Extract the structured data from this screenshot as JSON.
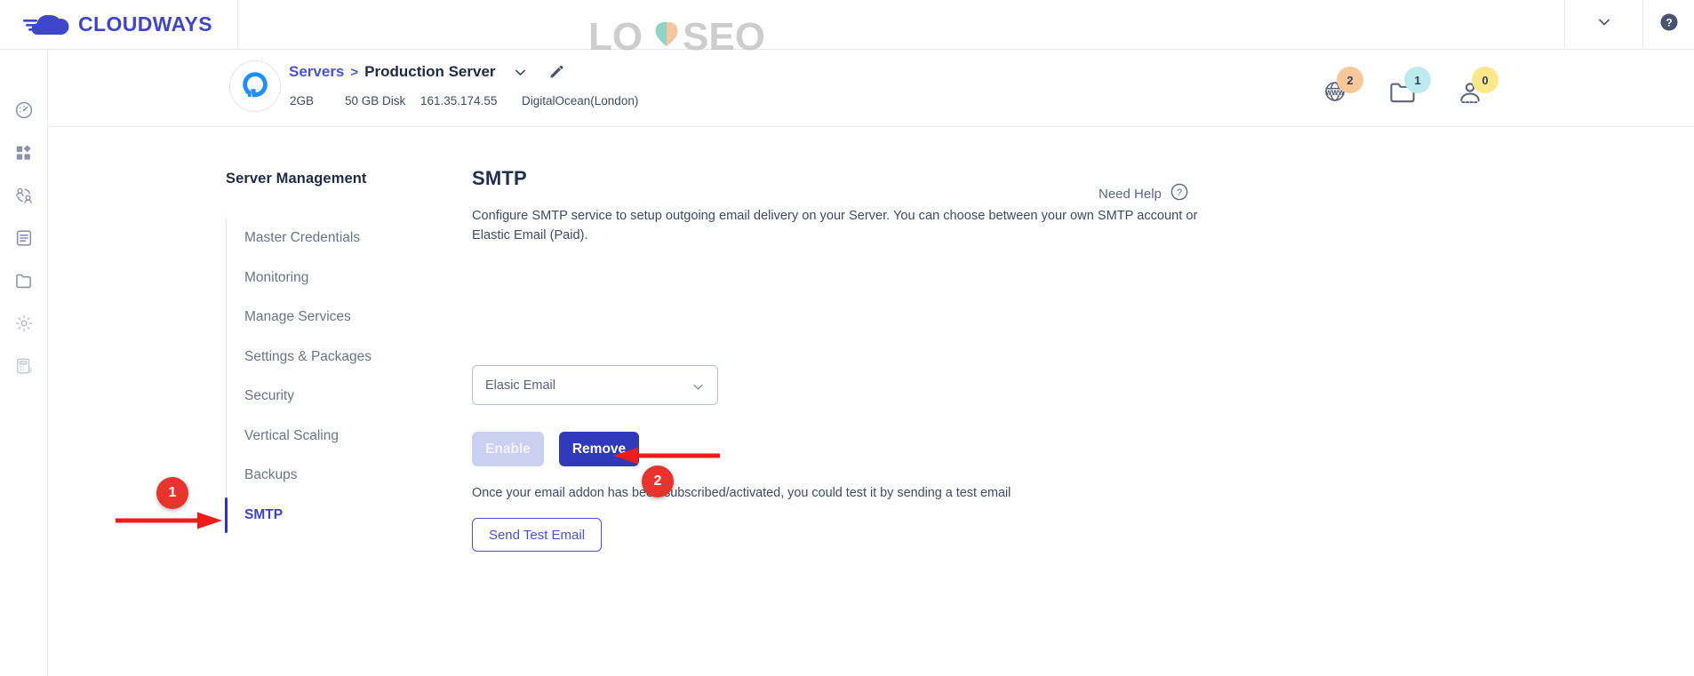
{
  "topbar": {
    "brand_name": "CLOUDWAYS",
    "brand_logo_icon": "cloudways-cloud-logo",
    "caret_icon": "chevron-down-icon",
    "help_icon": "question-mark-circle-icon"
  },
  "watermark": {
    "text": "LOYSEO",
    "heart_icon": "heart-icon"
  },
  "rail": {
    "items": [
      {
        "icon": "dashboard-gauge-icon",
        "name": "rail-item-dashboard"
      },
      {
        "icon": "grid-apps-icon",
        "name": "rail-item-applications"
      },
      {
        "icon": "team-users-icon",
        "name": "rail-item-team"
      },
      {
        "icon": "document-list-icon",
        "name": "rail-item-activity"
      },
      {
        "icon": "folder-icon",
        "name": "rail-item-projects"
      },
      {
        "icon": "gear-icon",
        "name": "rail-item-settings"
      },
      {
        "icon": "billing-calculator-icon",
        "name": "rail-item-billing"
      }
    ]
  },
  "server_header": {
    "provider_logo_icon": "digitalocean-logo-icon",
    "breadcrumb_root": "Servers",
    "breadcrumb_separator": ">",
    "breadcrumb_current": "Production Server",
    "caret_icon": "chevron-down-icon",
    "edit_icon": "pencil-edit-icon",
    "specs": {
      "ram": "2GB",
      "disk": "50 GB Disk",
      "ip": "161.35.174.55",
      "provider": "DigitalOcean(London)"
    },
    "counters": [
      {
        "name": "counter-applications",
        "icon": "www-globe-icon",
        "value": "2",
        "badge_color": "#f8c89a"
      },
      {
        "name": "counter-projects",
        "icon": "folder-icon",
        "value": "1",
        "badge_color": "#bdeaea"
      },
      {
        "name": "counter-team",
        "icon": "user-icon",
        "value": "0",
        "badge_color": "#fae88a"
      }
    ]
  },
  "nav": {
    "title": "Server Management",
    "items": [
      {
        "label": "Master Credentials",
        "active": false
      },
      {
        "label": "Monitoring",
        "active": false
      },
      {
        "label": "Manage Services",
        "active": false
      },
      {
        "label": "Settings & Packages",
        "active": false
      },
      {
        "label": "Security",
        "active": false
      },
      {
        "label": "Vertical Scaling",
        "active": false
      },
      {
        "label": "Backups",
        "active": false
      },
      {
        "label": "SMTP",
        "active": true
      }
    ]
  },
  "content": {
    "title": "SMTP",
    "description": "Configure SMTP service to setup outgoing email delivery on your Server. You can choose between your own SMTP account or Elastic Email (Paid).",
    "need_help_label": "Need Help",
    "need_help_icon": "question-mark-circle-icon",
    "select": {
      "value": "Elasic Email",
      "caret_icon": "chevron-down-icon",
      "options": [
        "Elasic Email"
      ]
    },
    "enable_label": "Enable",
    "remove_label": "Remove",
    "test_hint": "Once your email addon has been subscribed/activated, you could test it by sending a test email",
    "send_test_label": "Send Test Email"
  },
  "annotations": [
    {
      "number": "1",
      "name": "annotation-marker-1"
    },
    {
      "number": "2",
      "name": "annotation-marker-2"
    }
  ],
  "colors": {
    "brand_blue": "#3f46c9",
    "primary_button": "#3039ba",
    "disabled_button": "#ccd0f0",
    "annotation_red": "#e8342c",
    "active_nav": "#3b44c9"
  }
}
